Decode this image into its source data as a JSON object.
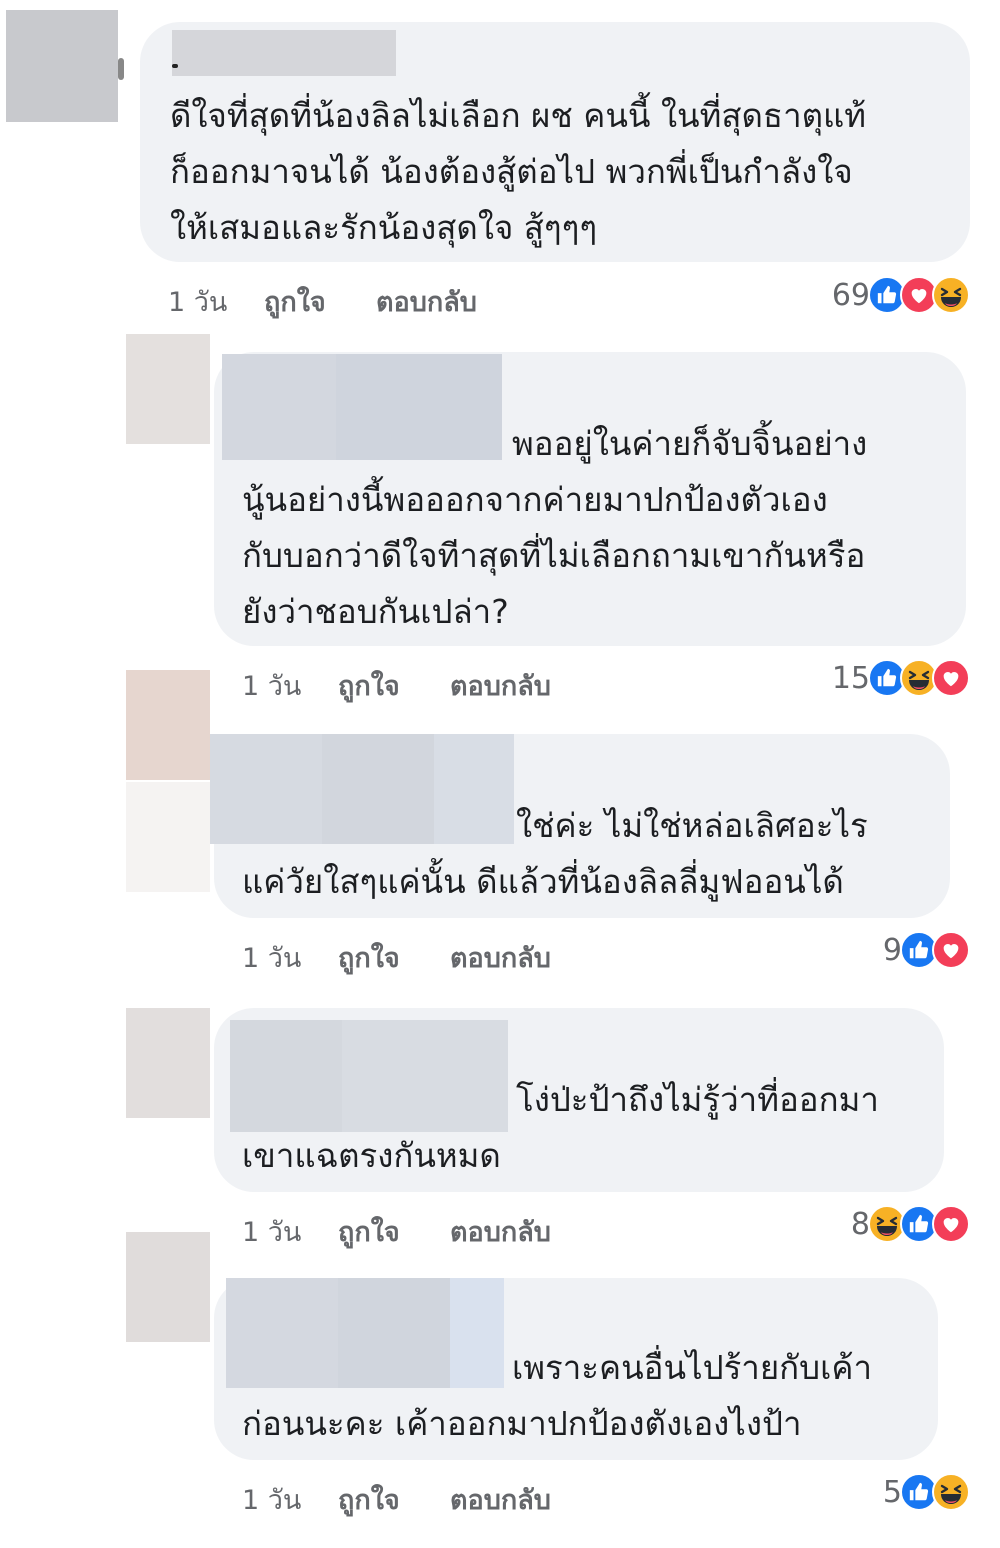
{
  "comments": [
    {
      "lines": [
        "ดีใจที่สุดที่น้องลิลไม่เลือก ผช คนนี้ ในที่สุดธาตุแท้",
        "ก็ออกมาจนได้ น้องต้องสู้ต่อไป พวกพี่เป็นกำลังใจ",
        "ให้เสมอและรักน้องสุดใจ สู้ๆๆๆ"
      ],
      "time": "1 วัน",
      "like": "ถูกใจ",
      "reply": "ตอบกลับ",
      "count": "69",
      "reactions": [
        "like",
        "love",
        "haha"
      ]
    },
    {
      "lines": [
        "พออยู่ในค่ายก็จับจิ้นอย่าง",
        "นู้นอย่างนี้พอออกจากค่ายมาปกป้องตัวเอง",
        "กับบอกว่าดีใจทีาสุดที่ไม่เลือกถามเขากันหรือ",
        "ยังว่าชอบกันเปล่า?"
      ],
      "time": "1 วัน",
      "like": "ถูกใจ",
      "reply": "ตอบกลับ",
      "count": "15",
      "reactions": [
        "like",
        "haha",
        "love"
      ]
    },
    {
      "lines": [
        "ใช่ค่ะ ไม่ใช่หล่อเลิศอะไร",
        "แค่วัยใสๆแค่นั้น  ดีแล้วที่น้องลิลลี่มูฟออนได้"
      ],
      "time": "1 วัน",
      "like": "ถูกใจ",
      "reply": "ตอบกลับ",
      "count": "9",
      "reactions": [
        "like",
        "love"
      ]
    },
    {
      "lines": [
        "โง่ป่ะป้าถึงไม่รู้ว่าที่ออกมา",
        "เขาแฉตรงกันหมด"
      ],
      "time": "1 วัน",
      "like": "ถูกใจ",
      "reply": "ตอบกลับ",
      "count": "8",
      "reactions": [
        "haha",
        "like",
        "love"
      ]
    },
    {
      "lines": [
        "เพราะคนอื่นไปร้ายกับเค้า",
        "ก่อนนะคะ เค้าออกมาปกป้องตังเองไงป้า"
      ],
      "time": "1 วัน",
      "like": "ถูกใจ",
      "reply": "ตอบกลับ",
      "count": "5",
      "reactions": [
        "like",
        "haha"
      ]
    }
  ],
  "colors": {
    "bubble": "#f0f2f5",
    "like": "#1877f2",
    "love": "#f33e58",
    "haha": "#f7b125",
    "meta": "#65676b"
  }
}
